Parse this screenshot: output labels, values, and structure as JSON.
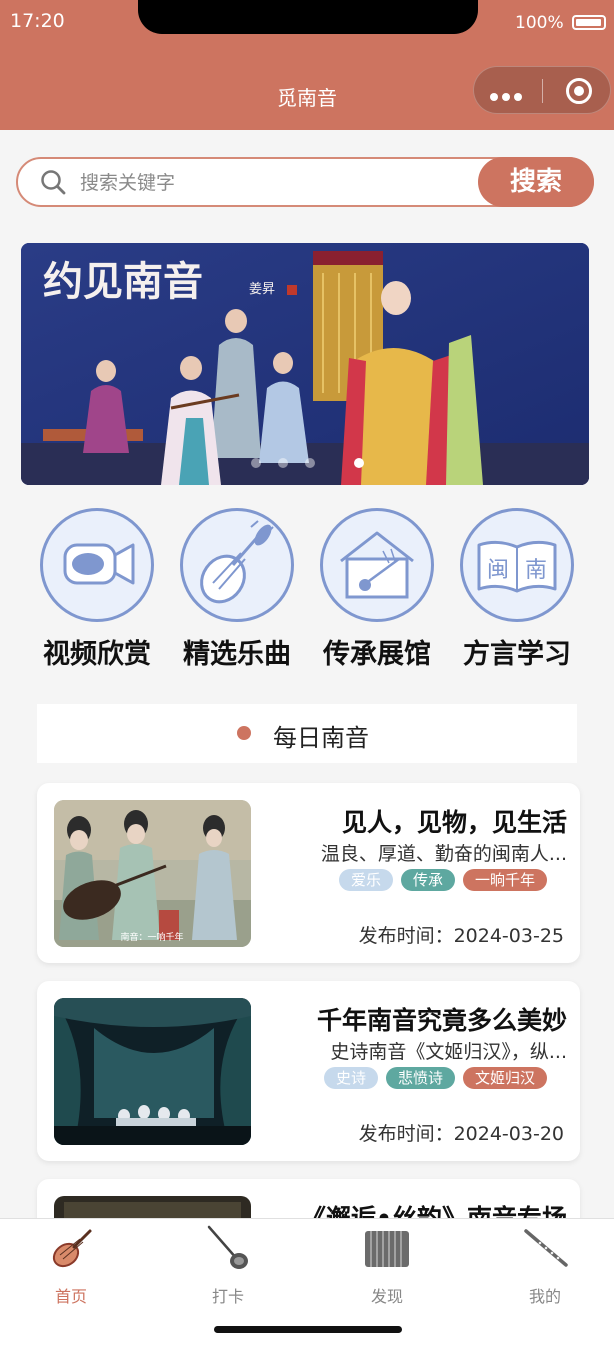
{
  "status_bar": {
    "time": "17:20",
    "battery": "100%"
  },
  "navbar": {
    "title": "觅南音"
  },
  "search": {
    "placeholder": "搜索关键字",
    "button_label": "搜索"
  },
  "banner": {
    "title_art": "约见南音",
    "signature": "姜昇",
    "active_index": 3,
    "dot_count": 4
  },
  "categories": [
    {
      "label": "视频欣赏",
      "icon": "video-camera-icon"
    },
    {
      "label": "精选乐曲",
      "icon": "pipa-lute-icon"
    },
    {
      "label": "传承展馆",
      "icon": "museum-house-icon"
    },
    {
      "label": "方言学习",
      "icon": "dialect-book-icon",
      "book_text": [
        "闽",
        "南"
      ]
    }
  ],
  "daily": {
    "title": "每日南音"
  },
  "cards": [
    {
      "title": "见人，见物，见生活",
      "subtitle": "温良、厚道、勤奋的闽南人...",
      "thumb_caption": "南音：一响千年",
      "tags": [
        {
          "text": "爱乐",
          "color": "blue"
        },
        {
          "text": "传承",
          "color": "teal"
        },
        {
          "text": "一晌千年",
          "color": "red"
        }
      ],
      "date_label": "发布时间：",
      "date": "2024-03-25"
    },
    {
      "title": "千年南音究竟多么美妙",
      "subtitle": "史诗南音《文姬归汉》，纵...",
      "tags": [
        {
          "text": "史诗",
          "color": "blue"
        },
        {
          "text": "悲愤诗",
          "color": "teal"
        },
        {
          "text": "文姬归汉",
          "color": "red"
        }
      ],
      "date_label": "发布时间：",
      "date": "2024-03-20"
    },
    {
      "title": "《邂逅•丝韵》南音专场"
    }
  ],
  "tabbar": {
    "items": [
      {
        "label": "首页",
        "icon": "pipa-icon",
        "active": true
      },
      {
        "label": "打卡",
        "icon": "sanxian-icon",
        "active": false
      },
      {
        "label": "发现",
        "icon": "paiban-clapper-icon",
        "active": false
      },
      {
        "label": "我的",
        "icon": "dongxiao-flute-icon",
        "active": false
      }
    ]
  },
  "colors": {
    "brand": "#cd7460",
    "icon_blue": "#7f97cf",
    "tag_blue": "#c6d9ec",
    "tag_teal": "#5ea8a0"
  }
}
